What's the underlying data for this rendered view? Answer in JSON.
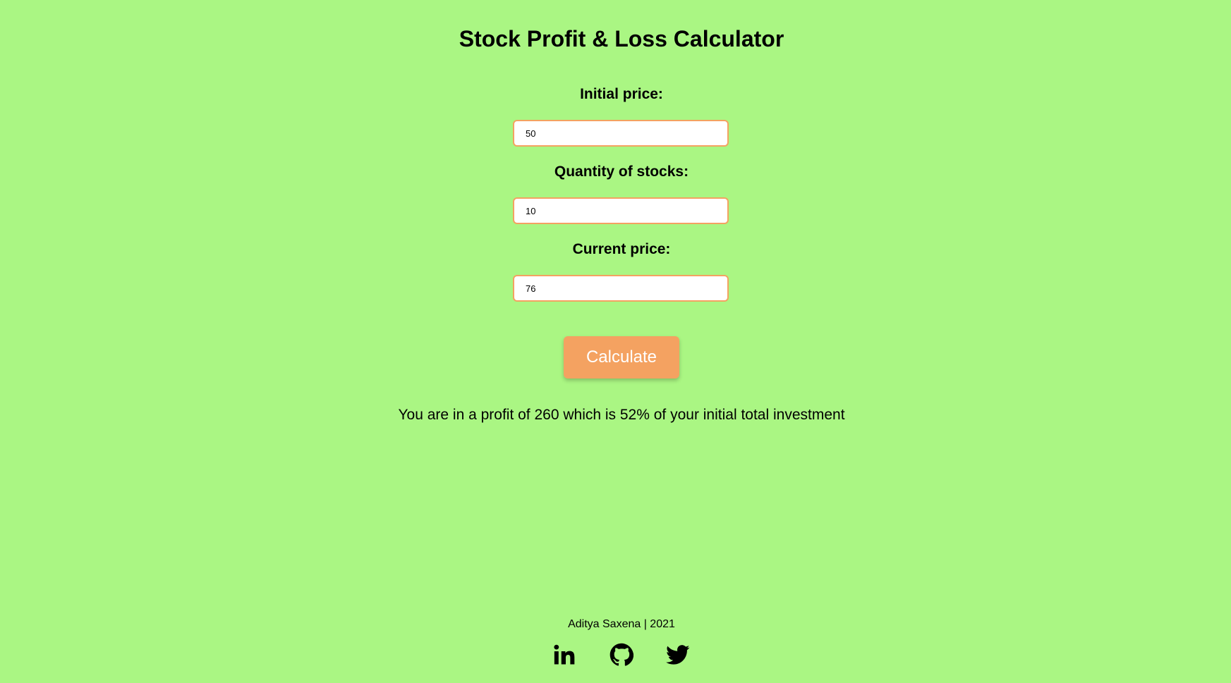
{
  "page": {
    "title": "Stock Profit & Loss Calculator"
  },
  "form": {
    "initial_price": {
      "label": "Initial price:",
      "value": "50"
    },
    "quantity": {
      "label": "Quantity of stocks:",
      "value": "10"
    },
    "current_price": {
      "label": "Current price:",
      "value": "76"
    },
    "calculate_label": "Calculate"
  },
  "result": {
    "message": "You are in a profit of 260 which is 52% of your initial total investment"
  },
  "footer": {
    "credit": "Aditya Saxena | 2021",
    "links": [
      {
        "icon": "linkedin-icon"
      },
      {
        "icon": "github-icon"
      },
      {
        "icon": "twitter-icon"
      }
    ]
  },
  "colors": {
    "background": "#aaf683",
    "accent": "#f4a261",
    "text": "#000000"
  }
}
